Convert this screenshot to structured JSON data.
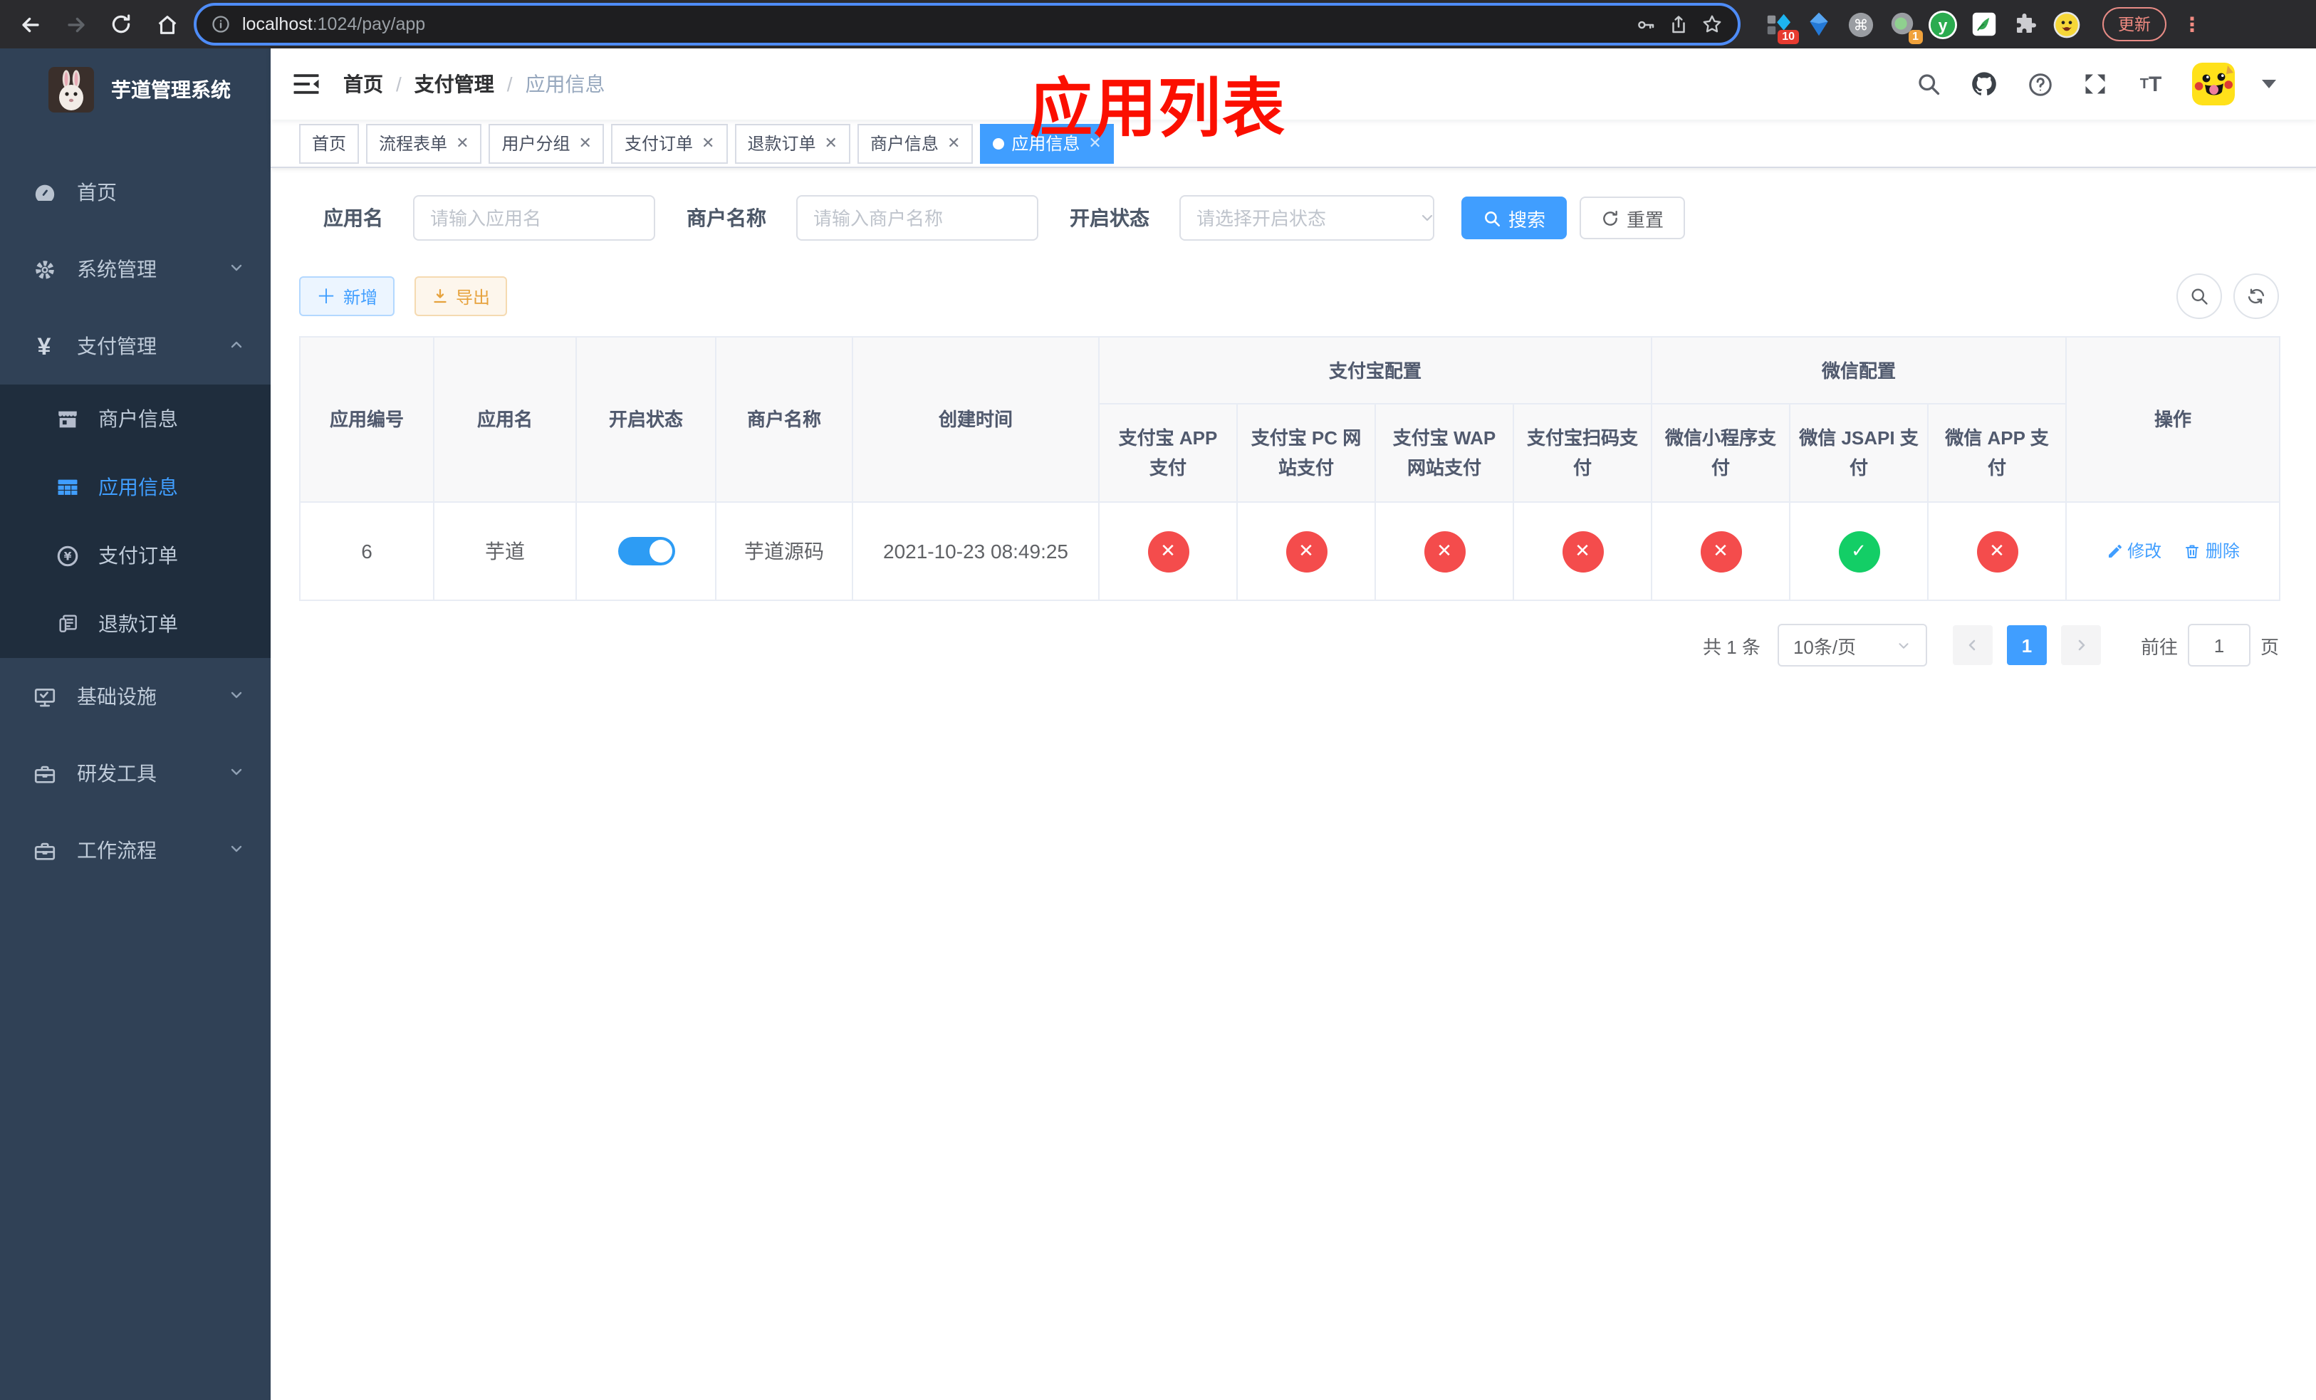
{
  "browser": {
    "url_host": "localhost",
    "url_path": ":1024/pay/app",
    "update_label": "更新",
    "ext_badge_blocks": "10",
    "ext_badge_proxy": "1",
    "icons": [
      "back-icon",
      "forward-icon",
      "reload-icon",
      "home-icon",
      "info-icon",
      "key-icon",
      "share-icon",
      "star-icon",
      "puzzle-icon",
      "profile-avatar"
    ]
  },
  "sidebar": {
    "title": "芋道管理系统",
    "items": [
      {
        "label": "首页",
        "icon": "dashboard-icon",
        "active": false
      },
      {
        "label": "系统管理",
        "icon": "gear-icon",
        "expanded": false
      },
      {
        "label": "支付管理",
        "icon": "yen-icon",
        "expanded": true
      },
      {
        "label": "商户信息",
        "icon": "shop-icon",
        "active": false
      },
      {
        "label": "应用信息",
        "icon": "grid-icon",
        "active": true
      },
      {
        "label": "支付订单",
        "icon": "pay-order-icon",
        "active": false
      },
      {
        "label": "退款订单",
        "icon": "refund-doc-icon",
        "active": false
      },
      {
        "label": "基础设施",
        "icon": "monitor-icon",
        "expanded": false
      },
      {
        "label": "研发工具",
        "icon": "toolbox-icon",
        "expanded": false
      },
      {
        "label": "工作流程",
        "icon": "workflow-icon",
        "expanded": false
      }
    ]
  },
  "breadcrumb": [
    "首页",
    "支付管理",
    "应用信息"
  ],
  "annotation": "应用列表",
  "tabs": [
    {
      "label": "首页",
      "closable": false,
      "active": false
    },
    {
      "label": "流程表单",
      "closable": true,
      "active": false
    },
    {
      "label": "用户分组",
      "closable": true,
      "active": false
    },
    {
      "label": "支付订单",
      "closable": true,
      "active": false
    },
    {
      "label": "退款订单",
      "closable": true,
      "active": false
    },
    {
      "label": "商户信息",
      "closable": true,
      "active": false
    },
    {
      "label": "应用信息",
      "closable": true,
      "active": true
    }
  ],
  "filters": {
    "app_name": {
      "label": "应用名",
      "placeholder": "请输入应用名",
      "value": ""
    },
    "merchant_name": {
      "label": "商户名称",
      "placeholder": "请输入商户名称",
      "value": ""
    },
    "status": {
      "label": "开启状态",
      "placeholder": "请选择开启状态",
      "value": ""
    },
    "search_label": "搜索",
    "reset_label": "重置"
  },
  "toolbar": {
    "add_label": "新增",
    "export_label": "导出"
  },
  "table": {
    "headers": {
      "app_id": "应用编号",
      "app_name": "应用名",
      "status": "开启状态",
      "merchant": "商户名称",
      "created": "创建时间",
      "alipay_group": "支付宝配置",
      "wechat_group": "微信配置",
      "ops": "操作",
      "channels": [
        "支付宝 APP 支付",
        "支付宝 PC 网站支付",
        "支付宝 WAP 网站支付",
        "支付宝扫码支付",
        "微信小程序支付",
        "微信 JSAPI 支付",
        "微信 APP 支付"
      ]
    },
    "row": {
      "app_id": "6",
      "app_name": "芋道",
      "enabled": true,
      "merchant": "芋道源码",
      "created": "2021-10-23 08:49:25",
      "channels": [
        {
          "name": "alipay-app",
          "enabled": false
        },
        {
          "name": "alipay-pc",
          "enabled": false
        },
        {
          "name": "alipay-wap",
          "enabled": false
        },
        {
          "name": "alipay-qr",
          "enabled": false
        },
        {
          "name": "wechat-lite",
          "enabled": false
        },
        {
          "name": "wechat-jsapi",
          "enabled": true
        },
        {
          "name": "wechat-app",
          "enabled": false
        }
      ],
      "edit_label": "修改",
      "delete_label": "删除"
    }
  },
  "pagination": {
    "total": "共 1 条",
    "page_size": "10条/页",
    "page": "1",
    "goto_prefix": "前往",
    "goto_value": "1",
    "goto_suffix": "页"
  },
  "colors": {
    "accent": "#409eff",
    "success": "#13ce66",
    "danger": "#f44c4c",
    "warning": "#e6a23c",
    "sidebar": "#304156",
    "sidebar_sub": "#1f2d3d"
  }
}
